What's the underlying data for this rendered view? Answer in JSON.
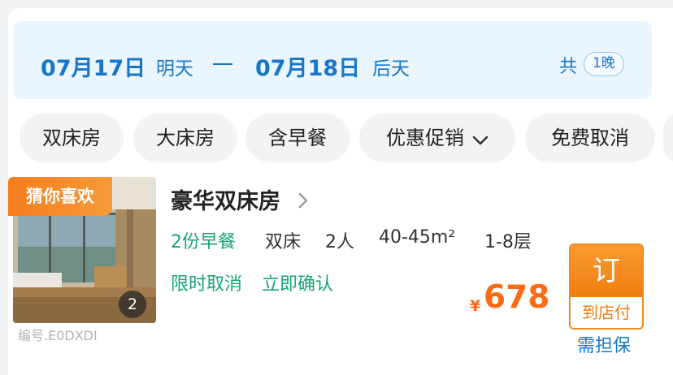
{
  "dates": {
    "checkin_date": "07月17日",
    "checkin_label": "明天",
    "checkout_date": "07月18日",
    "checkout_label": "后天",
    "total_prefix": "共",
    "nights": "1晚"
  },
  "filters": [
    {
      "label": "双床房"
    },
    {
      "label": "大床房"
    },
    {
      "label": "含早餐"
    },
    {
      "label": "优惠促销",
      "icon": "chevron-down-icon"
    },
    {
      "label": "免费取消"
    }
  ],
  "room": {
    "tag": "猜你喜欢",
    "photo_count": "2",
    "code": "编号.E0DXDI",
    "title": "豪华双床房",
    "breakfast": "2份早餐",
    "bed": "双床",
    "guests": "2人",
    "area": "40-45m²",
    "floor": "1-8层",
    "policy_cancel": "限时取消",
    "policy_confirm": "立即确认",
    "currency": "¥",
    "price": "678",
    "book_label": "订",
    "pay_label": "到店付",
    "guarantee": "需担保"
  },
  "colors": {
    "accent_blue": "#1677c8",
    "accent_green": "#17a37a",
    "accent_orange": "#ff6a13"
  }
}
